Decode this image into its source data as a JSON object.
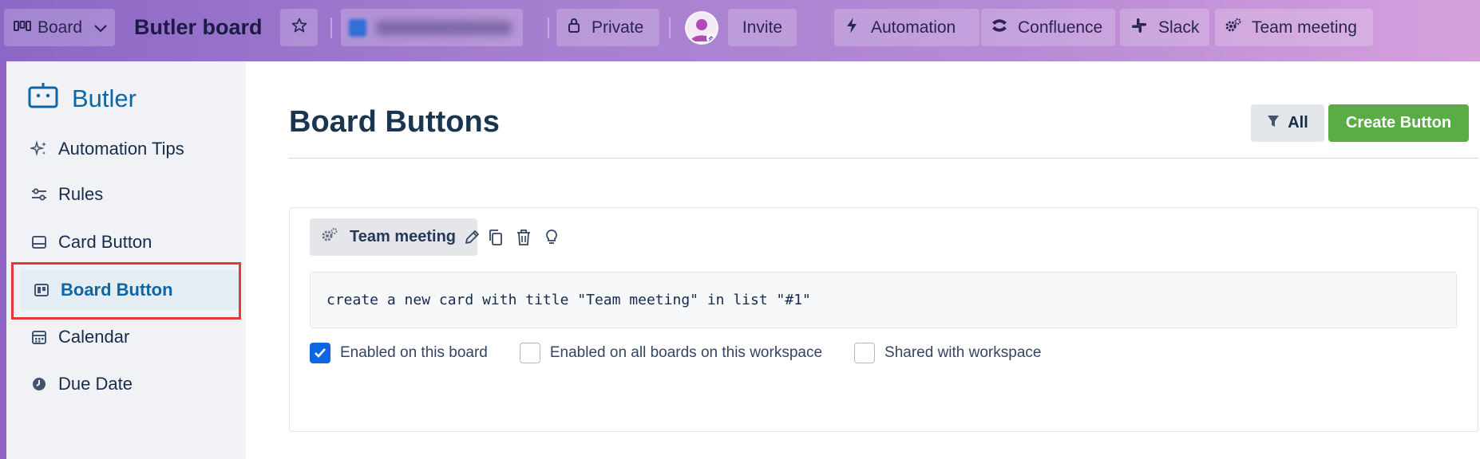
{
  "topbar": {
    "view_label": "Board",
    "board_title": "Butler board",
    "visibility_label": "Private",
    "invite_label": "Invite",
    "powerups": [
      {
        "label": "Automation",
        "icon": "bolt-icon"
      },
      {
        "label": "Confluence",
        "icon": "confluence-icon"
      },
      {
        "label": "Slack",
        "icon": "slack-icon"
      },
      {
        "label": "Team meeting",
        "icon": "gears-icon"
      }
    ]
  },
  "sidebar": {
    "brand": "Butler",
    "items": [
      {
        "label": "Automation Tips",
        "icon": "sparkle-icon"
      },
      {
        "label": "Rules",
        "icon": "sliders-icon"
      },
      {
        "label": "Card Button",
        "icon": "card-icon"
      },
      {
        "label": "Board Button",
        "icon": "board-icon",
        "active": true
      },
      {
        "label": "Calendar",
        "icon": "calendar-icon"
      },
      {
        "label": "Due Date",
        "icon": "clock-icon"
      }
    ]
  },
  "main": {
    "title": "Board Buttons",
    "filter_label": "All",
    "create_label": "Create Button",
    "button_card": {
      "name": "Team meeting",
      "command": "create a new card with title \"Team meeting\" in list \"#1\"",
      "options": [
        {
          "label": "Enabled on this board",
          "checked": true
        },
        {
          "label": "Enabled on all boards on this workspace",
          "checked": false
        },
        {
          "label": "Shared with workspace",
          "checked": false
        }
      ]
    }
  },
  "colors": {
    "accent": "#0c66a8",
    "create_button": "#5aac44",
    "checkbox": "#0c66e4",
    "highlight": "#e53935"
  }
}
